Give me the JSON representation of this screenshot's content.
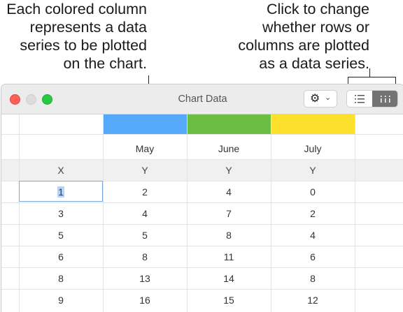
{
  "callouts": {
    "left": [
      "Each colored column",
      "represents a data",
      "series to be plotted",
      "on the chart."
    ],
    "right": [
      "Click to change",
      "whether rows or",
      "columns are plotted",
      "as a data series."
    ]
  },
  "window": {
    "title": "Chart Data",
    "gear_menu": {
      "icon": "gear-icon",
      "chevron": "⌄"
    },
    "plot_toggle": {
      "rows_icon": "list-rows-icon",
      "columns_icon": "columns-icon",
      "selected": "columns"
    }
  },
  "series": [
    {
      "name": "May",
      "color": "#55a8fa"
    },
    {
      "name": "June",
      "color": "#6cbd44"
    },
    {
      "name": "July",
      "color": "#fde02b"
    }
  ],
  "table": {
    "headers": [
      "X",
      "Y",
      "Y",
      "Y"
    ],
    "rows": [
      [
        "1",
        "2",
        "4",
        "0"
      ],
      [
        "3",
        "4",
        "7",
        "2"
      ],
      [
        "5",
        "5",
        "8",
        "4"
      ],
      [
        "6",
        "8",
        "11",
        "6"
      ],
      [
        "8",
        "13",
        "14",
        "8"
      ],
      [
        "9",
        "16",
        "15",
        "12"
      ]
    ],
    "selected_cell": {
      "row": 0,
      "col": 0
    }
  }
}
